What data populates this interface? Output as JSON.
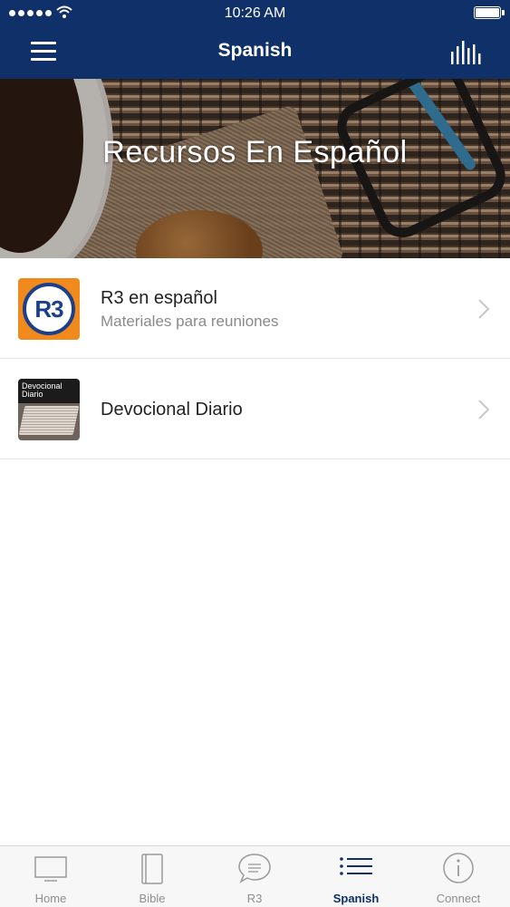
{
  "status_bar": {
    "time": "10:26 AM"
  },
  "nav": {
    "title": "Spanish",
    "left_icon": "hamburger-menu-icon",
    "right_icon": "audio-bars-icon"
  },
  "hero": {
    "title": "Recursos En Español"
  },
  "list": [
    {
      "title": "R3 en español",
      "subtitle": "Materiales para reuniones",
      "thumb_text": "R3"
    },
    {
      "title": "Devocional Diario",
      "thumb_text": "Devocional Diario"
    }
  ],
  "tabs": [
    {
      "label": "Home",
      "icon": "tv-icon"
    },
    {
      "label": "Bible",
      "icon": "book-icon"
    },
    {
      "label": "R3",
      "icon": "chat-bubble-icon"
    },
    {
      "label": "Spanish",
      "icon": "list-icon",
      "active": true
    },
    {
      "label": "Connect",
      "icon": "info-icon"
    }
  ],
  "colors": {
    "nav_bg": "#0f3068",
    "active_tab": "#0f3068",
    "r3_orange": "#f08a1c",
    "r3_blue": "#1c3f8c"
  }
}
